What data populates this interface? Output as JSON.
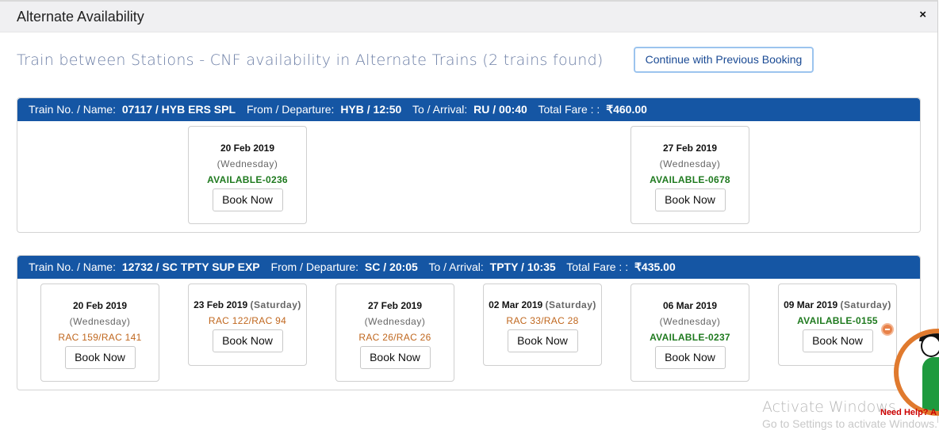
{
  "modal": {
    "title": "Alternate Availability",
    "close_icon": "×",
    "subtitle": "Train between Stations - CNF availability in Alternate Trains (2 trains found)",
    "continue_button": "Continue with Previous Booking"
  },
  "labels": {
    "train_no_name": "Train No. / Name:",
    "from_departure": "From / Departure:",
    "to_arrival": "To / Arrival:",
    "total_fare": "Total Fare : :",
    "book_now": "Book Now"
  },
  "trains": [
    {
      "number_name": "07117 / HYB ERS SPL",
      "departure": "HYB / 12:50",
      "arrival": "RU / 00:40",
      "fare": "₹460.00",
      "dates": [
        {
          "date": "20 Feb 2019",
          "day": "(Wednesday)",
          "status": "AVAILABLE-0236",
          "status_type": "available"
        },
        {
          "date": "27 Feb 2019",
          "day": "(Wednesday)",
          "status": "AVAILABLE-0678",
          "status_type": "available"
        }
      ]
    },
    {
      "number_name": "12732 / SC TPTY SUP EXP",
      "departure": "SC / 20:05",
      "arrival": "TPTY / 10:35",
      "fare": "₹435.00",
      "dates": [
        {
          "date": "20 Feb 2019",
          "day": "(Wednesday)",
          "status": "RAC 159/RAC 141",
          "status_type": "rac"
        },
        {
          "date": "23 Feb 2019",
          "day": "(Saturday)",
          "status": "RAC 122/RAC 94",
          "status_type": "rac"
        },
        {
          "date": "27 Feb 2019",
          "day": "(Wednesday)",
          "status": "RAC 26/RAC 26",
          "status_type": "rac"
        },
        {
          "date": "02 Mar 2019",
          "day": "(Saturday)",
          "status": "RAC 33/RAC 28",
          "status_type": "rac"
        },
        {
          "date": "06 Mar 2019",
          "day": "(Wednesday)",
          "status": "AVAILABLE-0237",
          "status_type": "available"
        },
        {
          "date": "09 Mar 2019",
          "day": "(Saturday)",
          "status": "AVAILABLE-0155",
          "status_type": "available"
        }
      ]
    }
  ],
  "colors": {
    "train_header_bg": "#1556a4",
    "available": "#1f7a1f",
    "rac": "#c0671e"
  },
  "overlay": {
    "watermark": "Activate Windows",
    "watermark_sub": "Go to Settings to activate Windows.",
    "help_text": "Need Help? A"
  }
}
